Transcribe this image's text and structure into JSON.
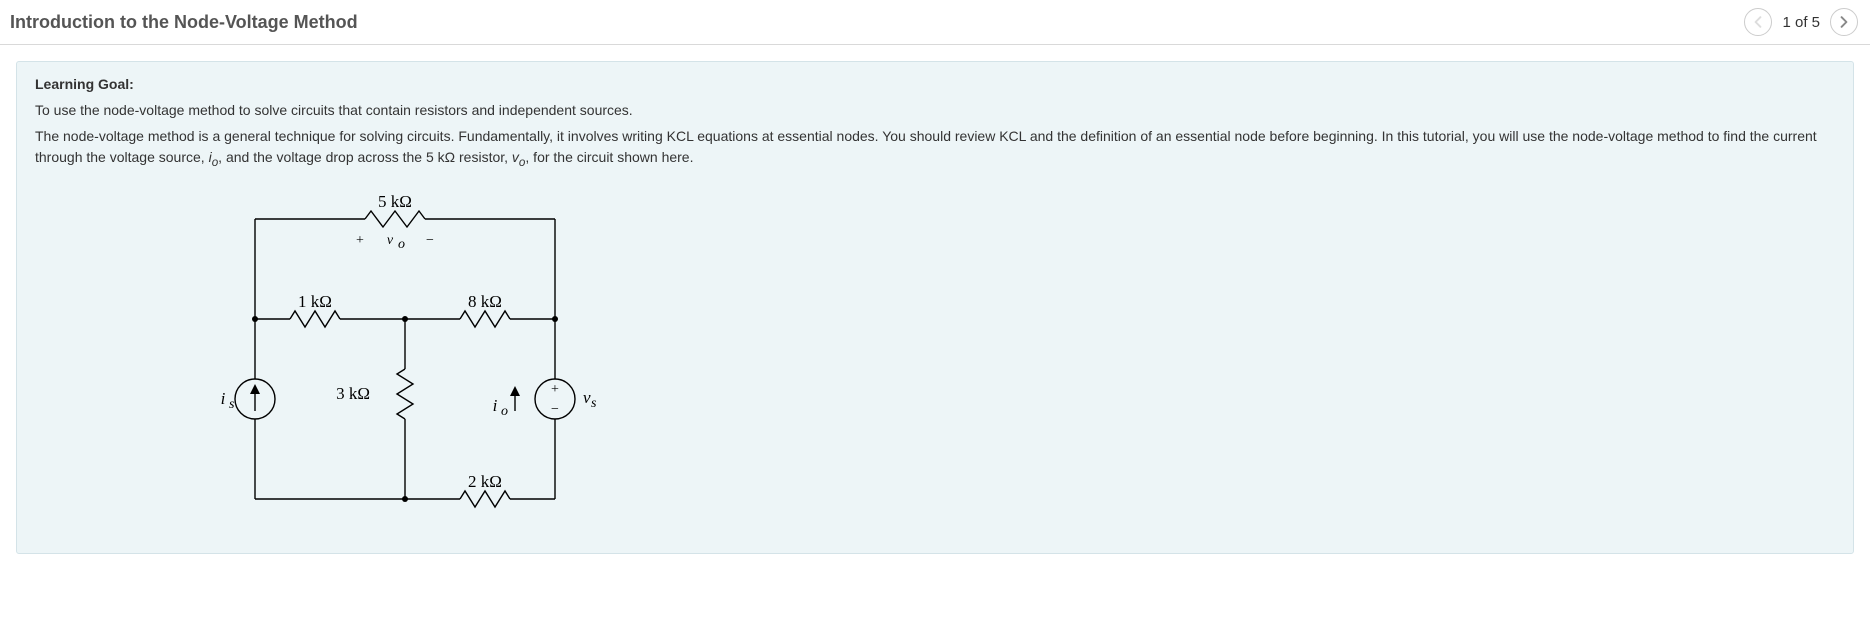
{
  "header": {
    "title": "Introduction to the Node-Voltage Method",
    "counter": "1 of 5"
  },
  "goal": {
    "label": "Learning Goal:",
    "intro": "To use the node-voltage method to solve circuits that contain resistors and independent sources.",
    "body_a": "The node-voltage method is a general technique for solving circuits. Fundamentally, it involves writing KCL equations at essential nodes. You should review KCL and the definition of an essential node before beginning.  In this tutorial, you will use the node-voltage method to find the current through the voltage source, ",
    "body_i": "i",
    "body_i_sub": "o",
    "body_b": ", and the voltage drop across the 5 ",
    "body_unit": "kΩ",
    "body_c": " resistor, ",
    "body_v": "v",
    "body_v_sub": "o",
    "body_d": ", for the circuit shown here."
  },
  "circuit": {
    "r5": "5 kΩ",
    "r1": "1 kΩ",
    "r8": "8 kΩ",
    "r3": "3 kΩ",
    "r2": "2 kΩ",
    "vo_plus": "+",
    "vo_sym": "v",
    "vo_sub": "o",
    "vo_minus": "−",
    "is_sym": "i",
    "is_sub": "s",
    "io_sym": "i",
    "io_sub": "o",
    "vs_sym": "v",
    "vs_sub": "s",
    "src_plus": "+",
    "src_minus": "−"
  }
}
